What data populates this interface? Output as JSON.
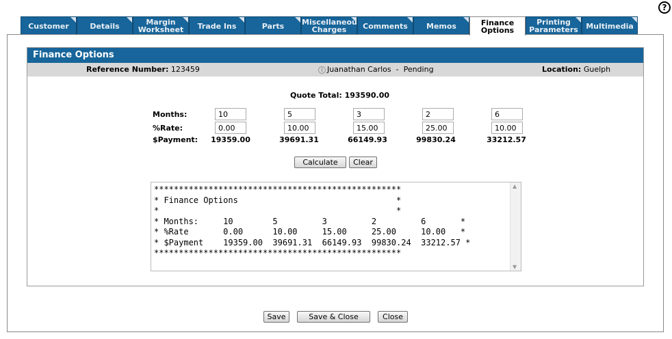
{
  "help_icon": "?",
  "tabs": [
    {
      "label": "Customer",
      "active": false
    },
    {
      "label": "Details",
      "active": false
    },
    {
      "label": "Margin Worksheet",
      "active": false
    },
    {
      "label": "Trade Ins",
      "active": false
    },
    {
      "label": "Parts",
      "active": false
    },
    {
      "label": "Miscellaneous Charges",
      "active": false
    },
    {
      "label": "Comments",
      "active": false
    },
    {
      "label": "Memos",
      "active": false
    },
    {
      "label": "Finance Options",
      "active": true
    },
    {
      "label": "Printing Parameters",
      "active": false
    },
    {
      "label": "Multimedia",
      "active": false
    }
  ],
  "panel": {
    "title": "Finance Options",
    "reference_label": "Reference Number:",
    "reference_value": "123459",
    "customer": "Juanathan Carlos  -  Pending",
    "location_label": "Location:",
    "location_value": "Guelph"
  },
  "quote_total_label": "Quote Total:",
  "quote_total_value": "193590.00",
  "labels": {
    "months": "Months:",
    "rate": "%Rate:",
    "payment": "$Payment:"
  },
  "options": [
    {
      "months": "10",
      "rate": "0.00",
      "payment": "19359.00"
    },
    {
      "months": "5",
      "rate": "10.00",
      "payment": "39691.31"
    },
    {
      "months": "3",
      "rate": "15.00",
      "payment": "66149.93"
    },
    {
      "months": "2",
      "rate": "25.00",
      "payment": "99830.24"
    },
    {
      "months": "6",
      "rate": "10.00",
      "payment": "33212.57"
    }
  ],
  "buttons": {
    "calculate": "Calculate",
    "clear": "Clear",
    "save": "Save",
    "save_close": "Save & Close",
    "close": "Close"
  },
  "summary_text": "**************************************************\n* Finance Options                                *\n*                                                *\n* Months:     10        5         3         2         6       *\n* %Rate       0.00      10.00     15.00     25.00     10.00   *\n* $Payment    19359.00  39691.31  66149.93  99830.24  33212.57 *\n**************************************************",
  "colors": {
    "tab_blue": "#17659a",
    "ref_bar": "#d8d8d8"
  }
}
